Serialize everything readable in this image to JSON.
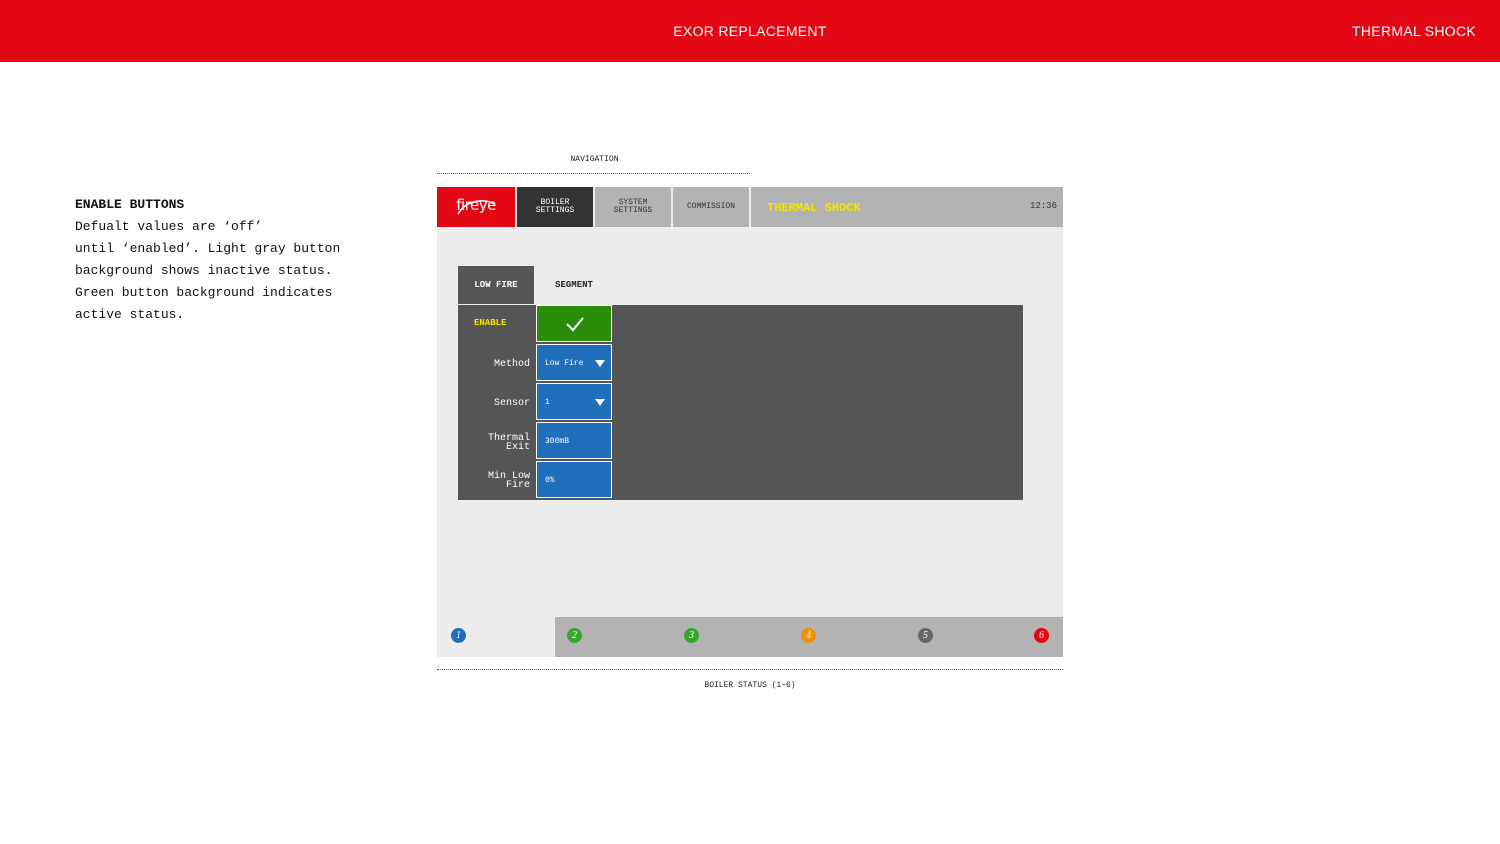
{
  "banner": {
    "title": "EXOR REPLACEMENT",
    "section": "THERMAL SHOCK"
  },
  "notes": {
    "heading": "ENABLE BUTTONS",
    "body": "Defualt values are ‘off’\nuntil ‘enabled’. Light gray button\nbackground shows inactive status.\nGreen button background indicates\nactive status."
  },
  "annotations": {
    "navigation": "NAVIGATION",
    "boiler_status": "BOILER STATUS (1–6)"
  },
  "hmi": {
    "logo": "fireye",
    "nav_tabs": [
      {
        "label": "BOILER\nSETTINGS",
        "active": true
      },
      {
        "label": "SYSTEM\nSETTINGS",
        "active": false
      },
      {
        "label": "COMMISSION",
        "active": false
      }
    ],
    "page_title": "THERMAL SHOCK",
    "clock": "12:36",
    "sub_tabs": [
      {
        "label": "LOW FIRE",
        "active": true
      },
      {
        "label": "SEGMENT",
        "active": false
      }
    ],
    "rows": [
      {
        "label": "ENABLE",
        "value": "",
        "type": "toggle",
        "state": "on"
      },
      {
        "label": "Method",
        "value": "Low Fire",
        "type": "dropdown"
      },
      {
        "label": "Sensor",
        "value": "1",
        "type": "dropdown"
      },
      {
        "label": "Thermal\nExit",
        "value": "300mB",
        "type": "input"
      },
      {
        "label": "Min Low\nFire",
        "value": "0%",
        "type": "input"
      }
    ],
    "boilers": [
      {
        "number": "1",
        "color": "#1f6fba"
      },
      {
        "number": "2",
        "color": "#3aa52e"
      },
      {
        "number": "3",
        "color": "#3aa52e"
      },
      {
        "number": "4",
        "color": "#f39200"
      },
      {
        "number": "5",
        "color": "#666666"
      },
      {
        "number": "6",
        "color": "#e30613"
      }
    ]
  },
  "colors": {
    "brand_red": "#e30613",
    "active_green": "#2b8c09",
    "field_blue": "#1f6fba",
    "title_yellow": "#f2e600"
  }
}
